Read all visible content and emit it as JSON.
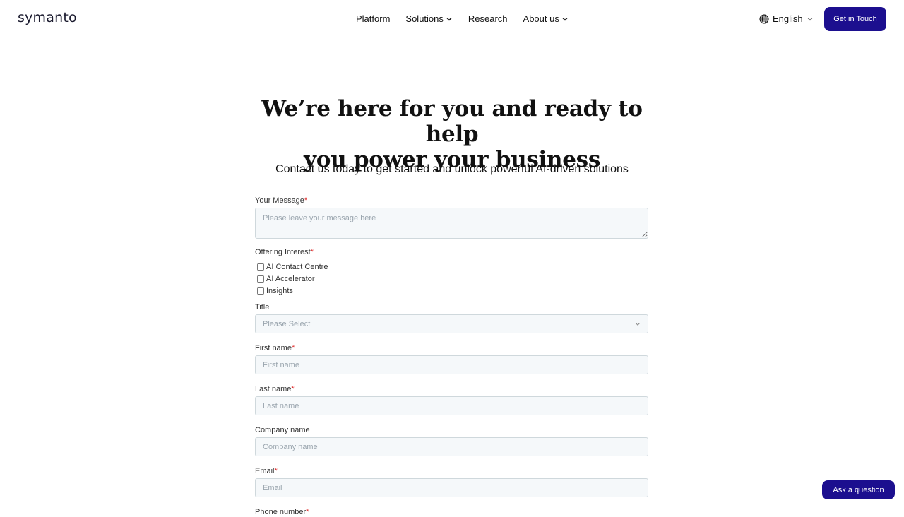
{
  "header": {
    "logo": "symanto",
    "nav": [
      {
        "label": "Platform",
        "has_dropdown": false
      },
      {
        "label": "Solutions",
        "has_dropdown": true
      },
      {
        "label": "Research",
        "has_dropdown": false
      },
      {
        "label": "About us",
        "has_dropdown": true
      }
    ],
    "language": "English",
    "cta_label": "Get in Touch"
  },
  "hero": {
    "title_line1": "We’re here for you and ready to help",
    "title_line2": "you power your business",
    "subtitle": "Contact us today to get started and unlock powerful AI-driven solutions"
  },
  "form": {
    "message": {
      "label": "Your Message",
      "required_mark": "*",
      "placeholder": "Please leave your message here"
    },
    "offering": {
      "label": "Offering Interest",
      "required_mark": "*",
      "options": [
        "AI Contact Centre",
        "AI Accelerator",
        "Insights"
      ]
    },
    "title": {
      "label": "Title",
      "placeholder": "Please Select"
    },
    "first_name": {
      "label": "First name",
      "required_mark": "*",
      "placeholder": "First name"
    },
    "last_name": {
      "label": "Last name",
      "required_mark": "*",
      "placeholder": "Last name"
    },
    "company": {
      "label": "Company name",
      "placeholder": "Company name"
    },
    "email": {
      "label": "Email",
      "required_mark": "*",
      "placeholder": "Email"
    },
    "phone": {
      "label": "Phone number",
      "required_mark": "*"
    }
  },
  "chat_button": "Ask a question",
  "colors": {
    "brand": "#1c0f8f",
    "required": "#e03030",
    "field_bg": "#f5f8fa"
  }
}
